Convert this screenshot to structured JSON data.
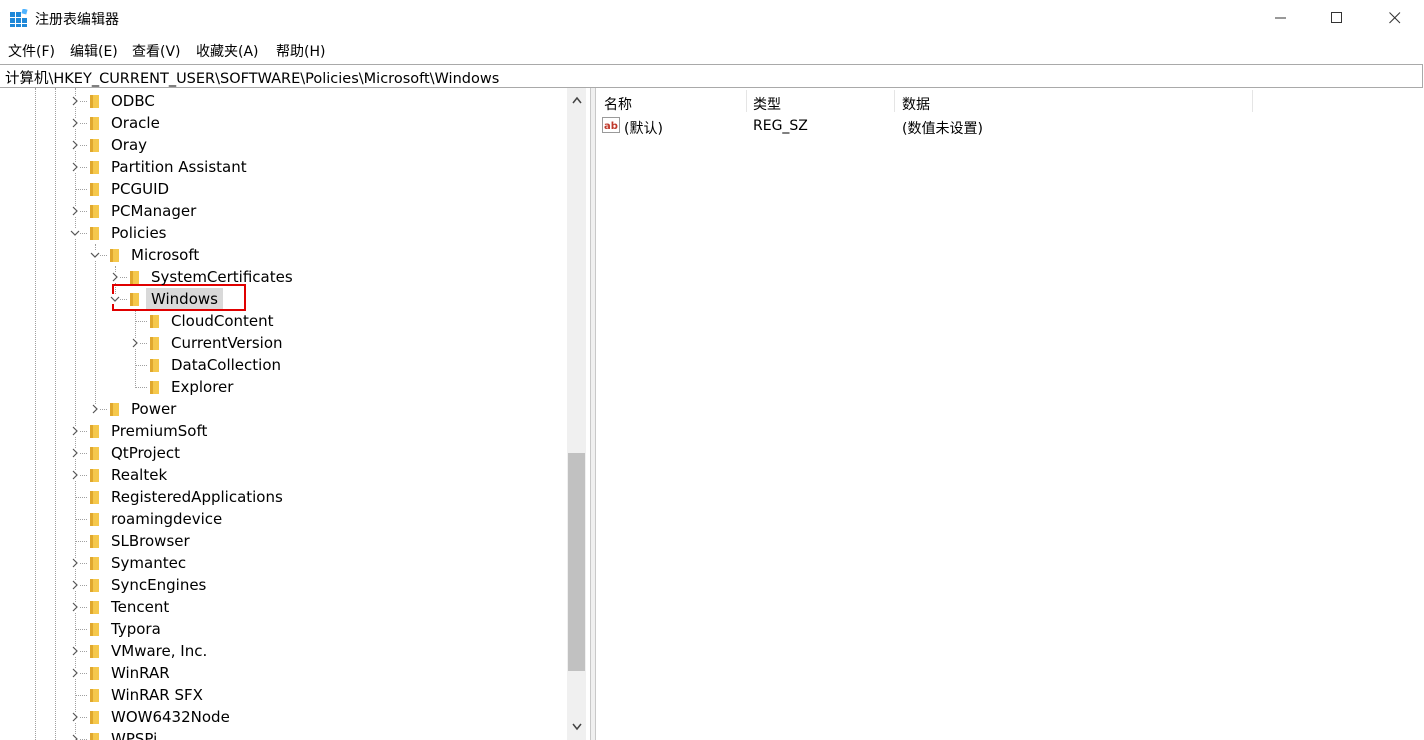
{
  "window": {
    "title": "注册表编辑器",
    "icon": "regedit-icon",
    "controls": {
      "minimize": "minimize-icon",
      "maximize": "maximize-icon",
      "close": "close-icon"
    }
  },
  "menu": [
    {
      "label": "文件(F)"
    },
    {
      "label": "编辑(E)"
    },
    {
      "label": "查看(V)"
    },
    {
      "label": "收藏夹(A)"
    },
    {
      "label": "帮助(H)"
    }
  ],
  "address": "计算机\\HKEY_CURRENT_USER\\SOFTWARE\\Policies\\Microsoft\\Windows",
  "tree": {
    "items": [
      {
        "label": "ODBC",
        "expander": "collapsed"
      },
      {
        "label": "Oracle",
        "expander": "collapsed"
      },
      {
        "label": "Oray",
        "expander": "collapsed"
      },
      {
        "label": "Partition Assistant",
        "expander": "collapsed"
      },
      {
        "label": "PCGUID",
        "expander": "none"
      },
      {
        "label": "PCManager",
        "expander": "collapsed"
      },
      {
        "label": "Policies",
        "expander": "expanded"
      },
      {
        "label": "Microsoft",
        "expander": "expanded"
      },
      {
        "label": "SystemCertificates",
        "expander": "collapsed"
      },
      {
        "label": "Windows",
        "expander": "expanded",
        "selected": true
      },
      {
        "label": "CloudContent",
        "expander": "none"
      },
      {
        "label": "CurrentVersion",
        "expander": "collapsed"
      },
      {
        "label": "DataCollection",
        "expander": "none"
      },
      {
        "label": "Explorer",
        "expander": "none"
      },
      {
        "label": "Power",
        "expander": "collapsed"
      },
      {
        "label": "PremiumSoft",
        "expander": "collapsed"
      },
      {
        "label": "QtProject",
        "expander": "collapsed"
      },
      {
        "label": "Realtek",
        "expander": "collapsed"
      },
      {
        "label": "RegisteredApplications",
        "expander": "none"
      },
      {
        "label": "roamingdevice",
        "expander": "none"
      },
      {
        "label": "SLBrowser",
        "expander": "none"
      },
      {
        "label": "Symantec",
        "expander": "collapsed"
      },
      {
        "label": "SyncEngines",
        "expander": "collapsed"
      },
      {
        "label": "Tencent",
        "expander": "collapsed"
      },
      {
        "label": "Typora",
        "expander": "none"
      },
      {
        "label": "VMware, Inc.",
        "expander": "collapsed"
      },
      {
        "label": "WinRAR",
        "expander": "collapsed"
      },
      {
        "label": "WinRAR SFX",
        "expander": "none"
      },
      {
        "label": "WOW6432Node",
        "expander": "collapsed"
      },
      {
        "label": "WPSPi",
        "expander": "collapsed"
      }
    ]
  },
  "values_table": {
    "headers": {
      "name": "名称",
      "type": "类型",
      "data": "数据"
    },
    "rows": [
      {
        "icon": "string-value-icon",
        "name": "(默认)",
        "type": "REG_SZ",
        "data": "(数值未设置)"
      }
    ]
  },
  "colors": {
    "highlight_border": "#e00000",
    "folder": "#f5c84c",
    "selected": "#d9d9d9"
  }
}
